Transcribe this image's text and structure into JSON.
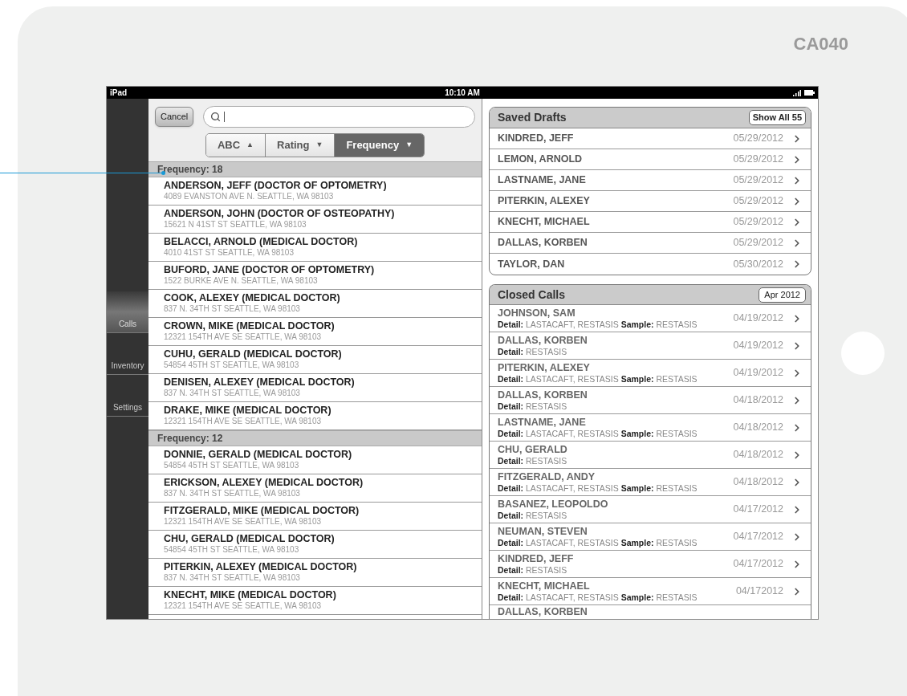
{
  "device_label": "CA040",
  "status_bar": {
    "carrier": "iPad",
    "time": "10:10 AM"
  },
  "sidebar": {
    "items": [
      {
        "label": "Calls",
        "selected": true
      },
      {
        "label": "Inventory",
        "selected": false
      },
      {
        "label": "Settings",
        "selected": false
      }
    ]
  },
  "search": {
    "cancel": "Cancel"
  },
  "sort_tabs": [
    {
      "label": "ABC",
      "arrow": "▲",
      "selected": false
    },
    {
      "label": "Rating",
      "arrow": "▼",
      "selected": false
    },
    {
      "label": "Frequency",
      "arrow": "▼",
      "selected": true
    }
  ],
  "groups": [
    {
      "title": "Frequency: 18",
      "rows": [
        {
          "name": "ANDERSON, JEFF (DOCTOR OF OPTOMETRY)",
          "address": "4089 EVANSTON AVE N. SEATTLE, WA 98103"
        },
        {
          "name": "ANDERSON, JOHN (DOCTOR OF OSTEOPATHY)",
          "address": "15621 N 41ST ST SEATTLE, WA 98103"
        },
        {
          "name": "BELACCI, ARNOLD (MEDICAL DOCTOR)",
          "address": "4010 41ST ST SEATTLE, WA 98103"
        },
        {
          "name": "BUFORD, JANE (DOCTOR OF OPTOMETRY)",
          "address": "1522 BURKE AVE N. SEATTLE, WA 98103"
        },
        {
          "name": "COOK, ALEXEY (MEDICAL DOCTOR)",
          "address": "837 N. 34TH ST SEATTLE, WA 98103"
        },
        {
          "name": "CROWN, MIKE (MEDICAL DOCTOR)",
          "address": "12321 154TH AVE SE SEATTLE, WA 98103"
        },
        {
          "name": "CUHU, GERALD (MEDICAL DOCTOR)",
          "address": "54854 45TH ST SEATTLE, WA 98103"
        },
        {
          "name": "DENISEN, ALEXEY (MEDICAL DOCTOR)",
          "address": "837 N. 34TH ST SEATTLE, WA 98103"
        },
        {
          "name": "DRAKE, MIKE (MEDICAL DOCTOR)",
          "address": "12321 154TH AVE SE SEATTLE, WA 98103"
        }
      ]
    },
    {
      "title": "Frequency: 12",
      "rows": [
        {
          "name": "DONNIE, GERALD (MEDICAL DOCTOR)",
          "address": "54854 45TH ST SEATTLE, WA 98103"
        },
        {
          "name": "ERICKSON, ALEXEY (MEDICAL DOCTOR)",
          "address": "837 N. 34TH ST SEATTLE, WA 98103"
        },
        {
          "name": "FITZGERALD, MIKE (MEDICAL DOCTOR)",
          "address": "12321 154TH AVE SE SEATTLE, WA 98103"
        },
        {
          "name": "CHU, GERALD (MEDICAL DOCTOR)",
          "address": "54854 45TH ST SEATTLE, WA 98103"
        },
        {
          "name": "PITERKIN, ALEXEY (MEDICAL DOCTOR)",
          "address": "837 N. 34TH ST SEATTLE, WA 98103"
        },
        {
          "name": "KNECHT, MIKE (MEDICAL DOCTOR)",
          "address": "12321 154TH AVE SE SEATTLE, WA 98103"
        }
      ]
    }
  ],
  "saved_drafts": {
    "title": "Saved Drafts",
    "button": "Show All 55",
    "rows": [
      {
        "name": "KINDRED, JEFF",
        "date": "05/29/2012"
      },
      {
        "name": "LEMON, ARNOLD",
        "date": "05/29/2012"
      },
      {
        "name": "LASTNAME, JANE",
        "date": "05/29/2012"
      },
      {
        "name": "PITERKIN, ALEXEY",
        "date": "05/29/2012"
      },
      {
        "name": "KNECHT, MICHAEL",
        "date": "05/29/2012"
      },
      {
        "name": "DALLAS, KORBEN",
        "date": "05/29/2012"
      },
      {
        "name": "TAYLOR, DAN",
        "date": "05/30/2012"
      }
    ]
  },
  "closed_calls": {
    "title": "Closed Calls",
    "button": "Apr 2012",
    "rows": [
      {
        "name": "JOHNSON, SAM",
        "detail": "**Detail:** LASTACAFT, RESTASIS **Sample:** RESTASIS",
        "date": "04/19/2012"
      },
      {
        "name": "DALLAS, KORBEN",
        "detail": "**Detail:** RESTASIS",
        "date": "04/19/2012"
      },
      {
        "name": "PITERKIN, ALEXEY",
        "detail": "**Detail:** LASTACAFT, RESTASIS **Sample:** RESTASIS",
        "date": "04/19/2012"
      },
      {
        "name": "DALLAS, KORBEN",
        "detail": "**Detail:** RESTASIS",
        "date": "04/18/2012"
      },
      {
        "name": "LASTNAME, JANE",
        "detail": "**Detail:** LASTACAFT, RESTASIS **Sample:** RESTASIS",
        "date": "04/18/2012"
      },
      {
        "name": "CHU, GERALD",
        "detail": "**Detail:** RESTASIS",
        "date": "04/18/2012"
      },
      {
        "name": "FITZGERALD, ANDY",
        "detail": "**Detail:** LASTACAFT, RESTASIS **Sample:** RESTASIS",
        "date": "04/18/2012"
      },
      {
        "name": "BASANEZ, LEOPOLDO",
        "detail": "**Detail:** RESTASIS",
        "date": "04/17/2012"
      },
      {
        "name": "NEUMAN, STEVEN",
        "detail": "**Detail:** LASTACAFT, RESTASIS **Sample:** RESTASIS",
        "date": "04/17/2012"
      },
      {
        "name": "KINDRED, JEFF",
        "detail": "**Detail:** RESTASIS",
        "date": "04/17/2012"
      },
      {
        "name": "KNECHT, MICHAEL",
        "detail": "**Detail:** LASTACAFT, RESTASIS **Sample:** RESTASIS",
        "date": "04/172012"
      },
      {
        "name": "DALLAS, KORBEN"
      }
    ]
  }
}
